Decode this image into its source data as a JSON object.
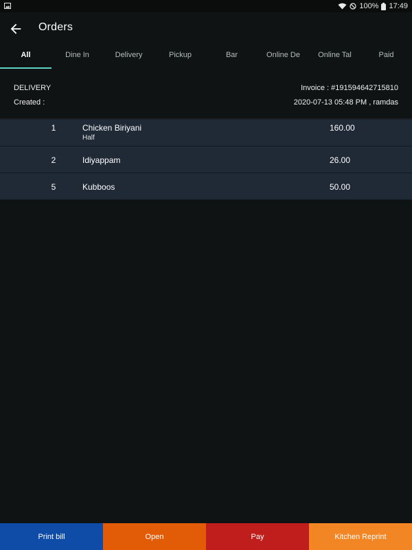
{
  "status_bar": {
    "battery": "100%",
    "time": "17:49"
  },
  "header": {
    "title": "Orders"
  },
  "tabs": [
    {
      "label": "All"
    },
    {
      "label": "Dine In"
    },
    {
      "label": "Delivery"
    },
    {
      "label": "Pickup"
    },
    {
      "label": "Bar"
    },
    {
      "label": "Online De"
    },
    {
      "label": "Online Tal"
    },
    {
      "label": "Paid"
    }
  ],
  "order": {
    "type": "DELIVERY",
    "created_label": "Created :",
    "invoice": "Invoice : #191594642715810",
    "datetime": "2020-07-13  05:48 PM , ramdas"
  },
  "items": [
    {
      "qty": "1",
      "name": "Chicken Biriyani",
      "variant": "Half",
      "price": "160.00"
    },
    {
      "qty": "2",
      "name": "Idiyappam",
      "variant": "",
      "price": "26.00"
    },
    {
      "qty": "5",
      "name": "Kubboos",
      "variant": "",
      "price": "50.00"
    }
  ],
  "actions": {
    "print_bill": "Print bill",
    "open": "Open",
    "pay": "Pay",
    "kitchen_reprint": "Kitchen Reprint"
  },
  "colors": {
    "background": "#101313",
    "tab_indicator": "#5ed5c4",
    "row_background": "#202a37",
    "print_bill": "#0f4ca8",
    "open": "#e25c08",
    "pay": "#c01d1d",
    "kitchen_reprint": "#f28524"
  }
}
